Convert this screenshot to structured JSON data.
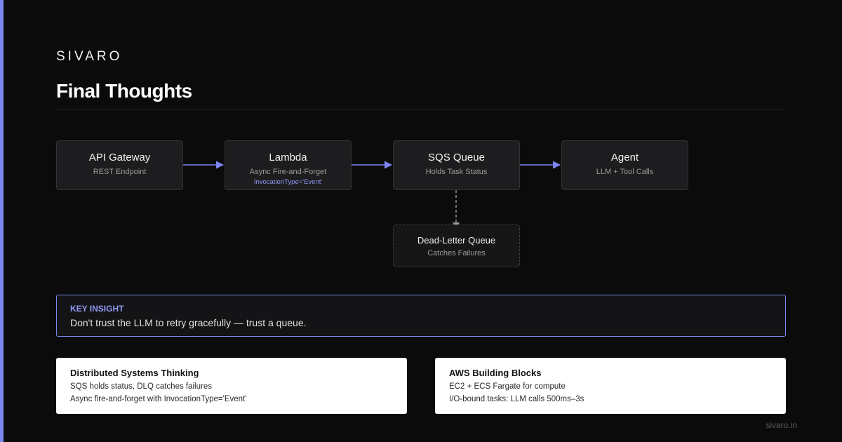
{
  "brand": "SIVARO",
  "title": "Final Thoughts",
  "diagram": {
    "nodes": [
      {
        "id": "api-gateway",
        "title": "API Gateway",
        "subtitle": "REST Endpoint",
        "note": ""
      },
      {
        "id": "lambda",
        "title": "Lambda",
        "subtitle": "Async Fire-and-Forget",
        "note": "InvocationType='Event'"
      },
      {
        "id": "sqs-queue",
        "title": "SQS Queue",
        "subtitle": "Holds Task Status",
        "note": ""
      },
      {
        "id": "agent",
        "title": "Agent",
        "subtitle": "LLM + Tool Calls",
        "note": ""
      },
      {
        "id": "dead-letter-queue",
        "title": "Dead-Letter Queue",
        "subtitle": "Catches Failures",
        "note": ""
      }
    ],
    "edges": [
      {
        "from": "api-gateway",
        "to": "lambda",
        "style": "solid"
      },
      {
        "from": "lambda",
        "to": "sqs-queue",
        "style": "solid"
      },
      {
        "from": "sqs-queue",
        "to": "agent",
        "style": "solid"
      },
      {
        "from": "sqs-queue",
        "to": "dead-letter-queue",
        "style": "dashed"
      }
    ],
    "colors": {
      "edge": "#7b86f0",
      "dashed_edge": "#8a8a8a"
    }
  },
  "insight": {
    "label": "KEY INSIGHT",
    "text": "Don't trust the LLM to retry gracefully — trust a queue."
  },
  "cards": [
    {
      "title": "Distributed Systems Thinking",
      "lines": [
        "SQS holds status, DLQ catches failures",
        "Async fire-and-forget with InvocationType='Event'"
      ]
    },
    {
      "title": "AWS Building Blocks",
      "lines": [
        "EC2 + ECS Fargate for compute",
        "I/O-bound tasks: LLM calls 500ms–3s"
      ]
    }
  ],
  "footer": "sivaro.in",
  "colors": {
    "accent": "#7b86f0",
    "background": "#0b0b0b"
  }
}
